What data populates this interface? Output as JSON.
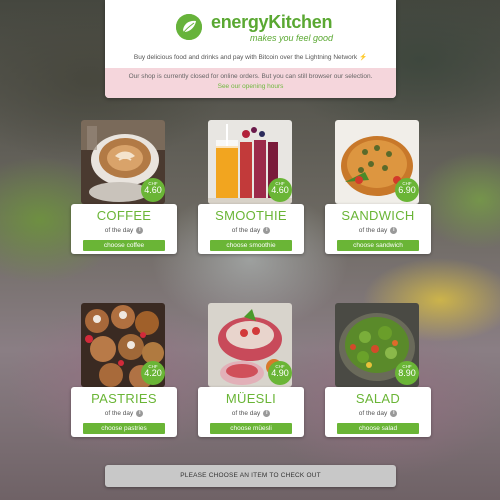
{
  "header": {
    "brand": "energyKitchen",
    "tagline": "makes you feel good",
    "subtitle": "Buy delicious food and drinks and pay with Bitcoin over the Lightning Network",
    "bolt": "⚡",
    "notice": "Our shop is currently closed for online orders. But you can still browser our selection.",
    "opening_hours_link": "See our opening hours"
  },
  "colors": {
    "brand_green": "#6ab536",
    "notice_bg": "#f5d6dc",
    "checkout_bg": "#c8c8c8"
  },
  "products": [
    {
      "name": "COFFEE",
      "currency": "CHF",
      "price": "4.60",
      "of_the_day": "of the day",
      "button": "choose coffee",
      "icon": "info-icon"
    },
    {
      "name": "SMOOTHIE",
      "currency": "CHF",
      "price": "4.60",
      "of_the_day": "of the day",
      "button": "choose smoothie",
      "icon": "info-icon"
    },
    {
      "name": "SANDWICH",
      "currency": "CHF",
      "price": "6.90",
      "of_the_day": "of the day",
      "button": "choose sandwich",
      "icon": "info-icon"
    },
    {
      "name": "PASTRIES",
      "currency": "CHF",
      "price": "4.20",
      "of_the_day": "of the day",
      "button": "choose pastries",
      "icon": "info-icon"
    },
    {
      "name": "MÜESLI",
      "currency": "CHF",
      "price": "4.90",
      "of_the_day": "of the day",
      "button": "choose müesli",
      "icon": "info-icon"
    },
    {
      "name": "SALAD",
      "currency": "CHF",
      "price": "8.90",
      "of_the_day": "of the day",
      "button": "choose salad",
      "icon": "info-icon"
    }
  ],
  "checkout": {
    "label": "PLEASE CHOOSE AN ITEM TO CHECK OUT"
  }
}
